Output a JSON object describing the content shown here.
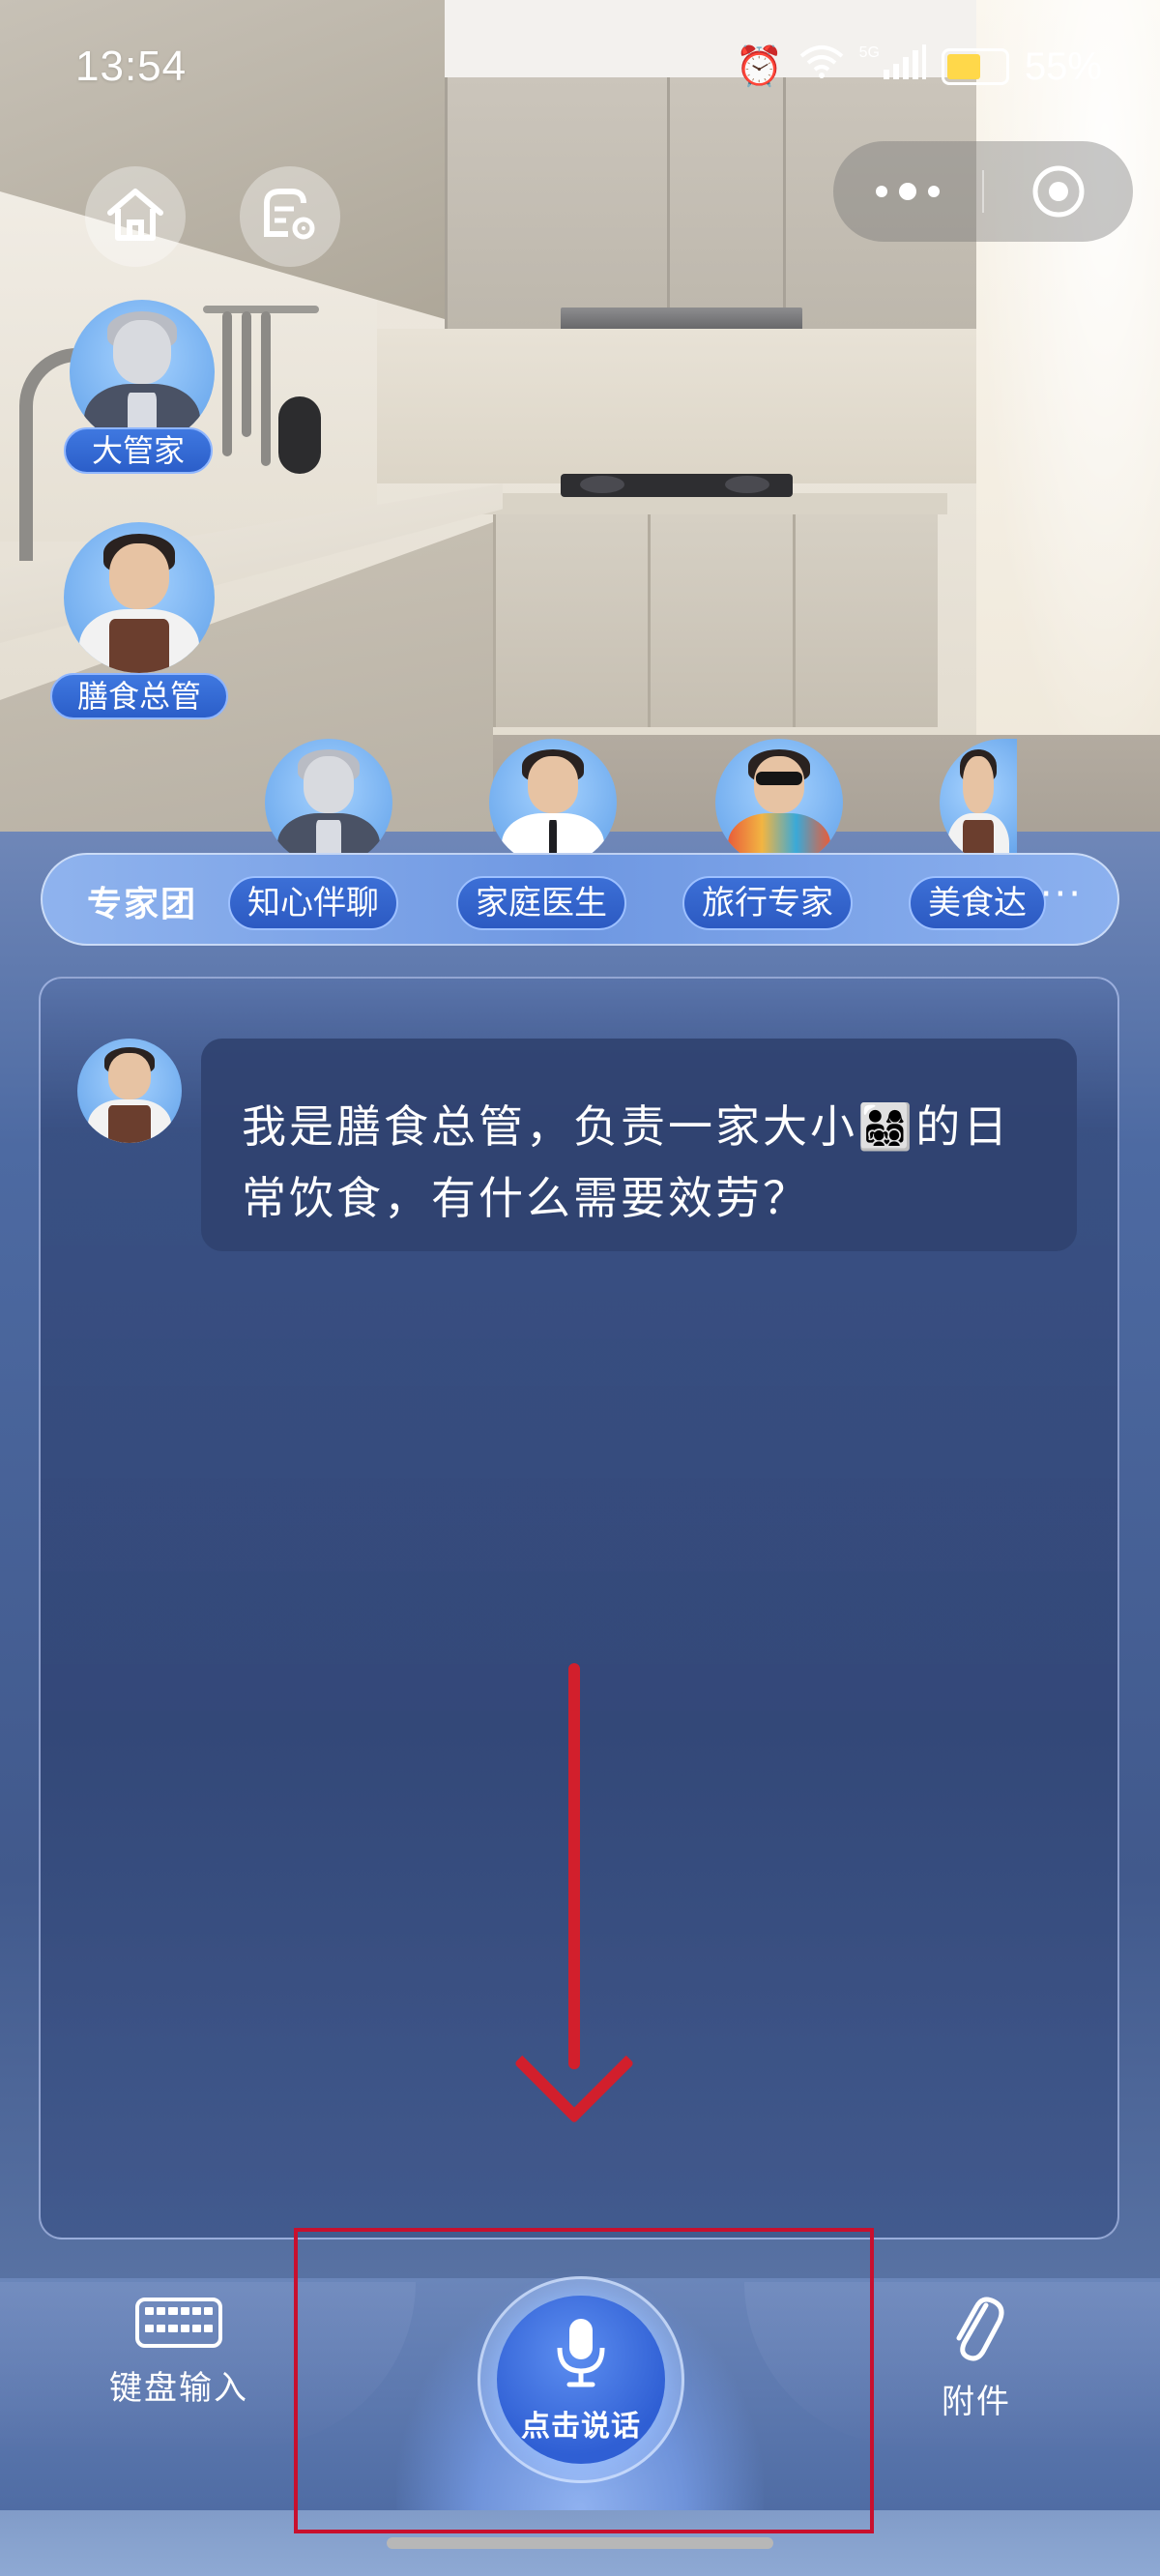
{
  "status_bar": {
    "time": "13:54",
    "network": "5G",
    "battery": "55%",
    "icons": [
      "alarm-icon",
      "wifi-icon",
      "signal-icon",
      "battery-charging-icon"
    ]
  },
  "top_controls": {
    "home_icon": "home-icon",
    "settings_icon": "settings-icon",
    "more_icon": "more-dots-icon",
    "close_icon": "target-icon"
  },
  "side_avatars": [
    {
      "label": "大管家"
    },
    {
      "label": "膳食总管"
    }
  ],
  "expert_team": {
    "title": "专家团",
    "members": [
      {
        "label": "知心伴聊"
      },
      {
        "label": "家庭医生"
      },
      {
        "label": "旅行专家"
      },
      {
        "label": "美食达"
      }
    ],
    "more_label": "···"
  },
  "chat": {
    "message": "我是膳食总管，负责一家大小👨‍👩‍👧‍👦的日常饮食，有什么需要效劳？"
  },
  "bottom_bar": {
    "keyboard_label": "键盘输入",
    "mic_label": "点击说话",
    "attach_label": "附件"
  },
  "colors": {
    "accent": "#2f5fd4",
    "annotation_red": "#c8102e",
    "panel_blue": "#41598c"
  }
}
